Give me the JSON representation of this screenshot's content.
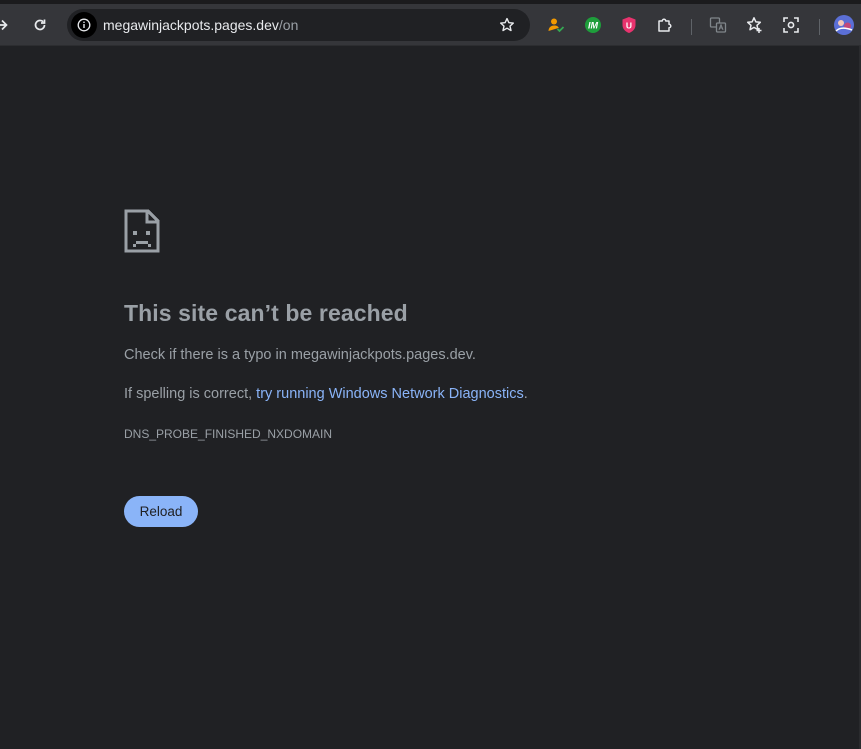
{
  "toolbar": {
    "url_host": "megawinjackpots.pages.dev",
    "url_path": "/on",
    "icons": [
      "forward-icon",
      "reload-icon",
      "site-info-icon",
      "bookmark-star-icon",
      "extension-person-check-icon",
      "extension-im-icon",
      "extension-shield-u-icon",
      "extensions-puzzle-icon",
      "translate-icon",
      "reading-list-star-icon",
      "screenshot-icon",
      "profile-avatar"
    ],
    "ext_im_label": "IM",
    "ext_shield_label": "U"
  },
  "error": {
    "title": "This site can’t be reached",
    "line1": "Check if there is a typo in megawinjackpots.pages.dev.",
    "line2_prefix": "If spelling is correct, ",
    "line2_link": "try running Windows Network Diagnostics",
    "line2_suffix": ".",
    "code": "DNS_PROBE_FINISHED_NXDOMAIN",
    "reload_label": "Reload"
  },
  "colors": {
    "background": "#202124",
    "text": "#9aa0a6",
    "link": "#8ab4f8",
    "button": "#8ab4f8"
  }
}
